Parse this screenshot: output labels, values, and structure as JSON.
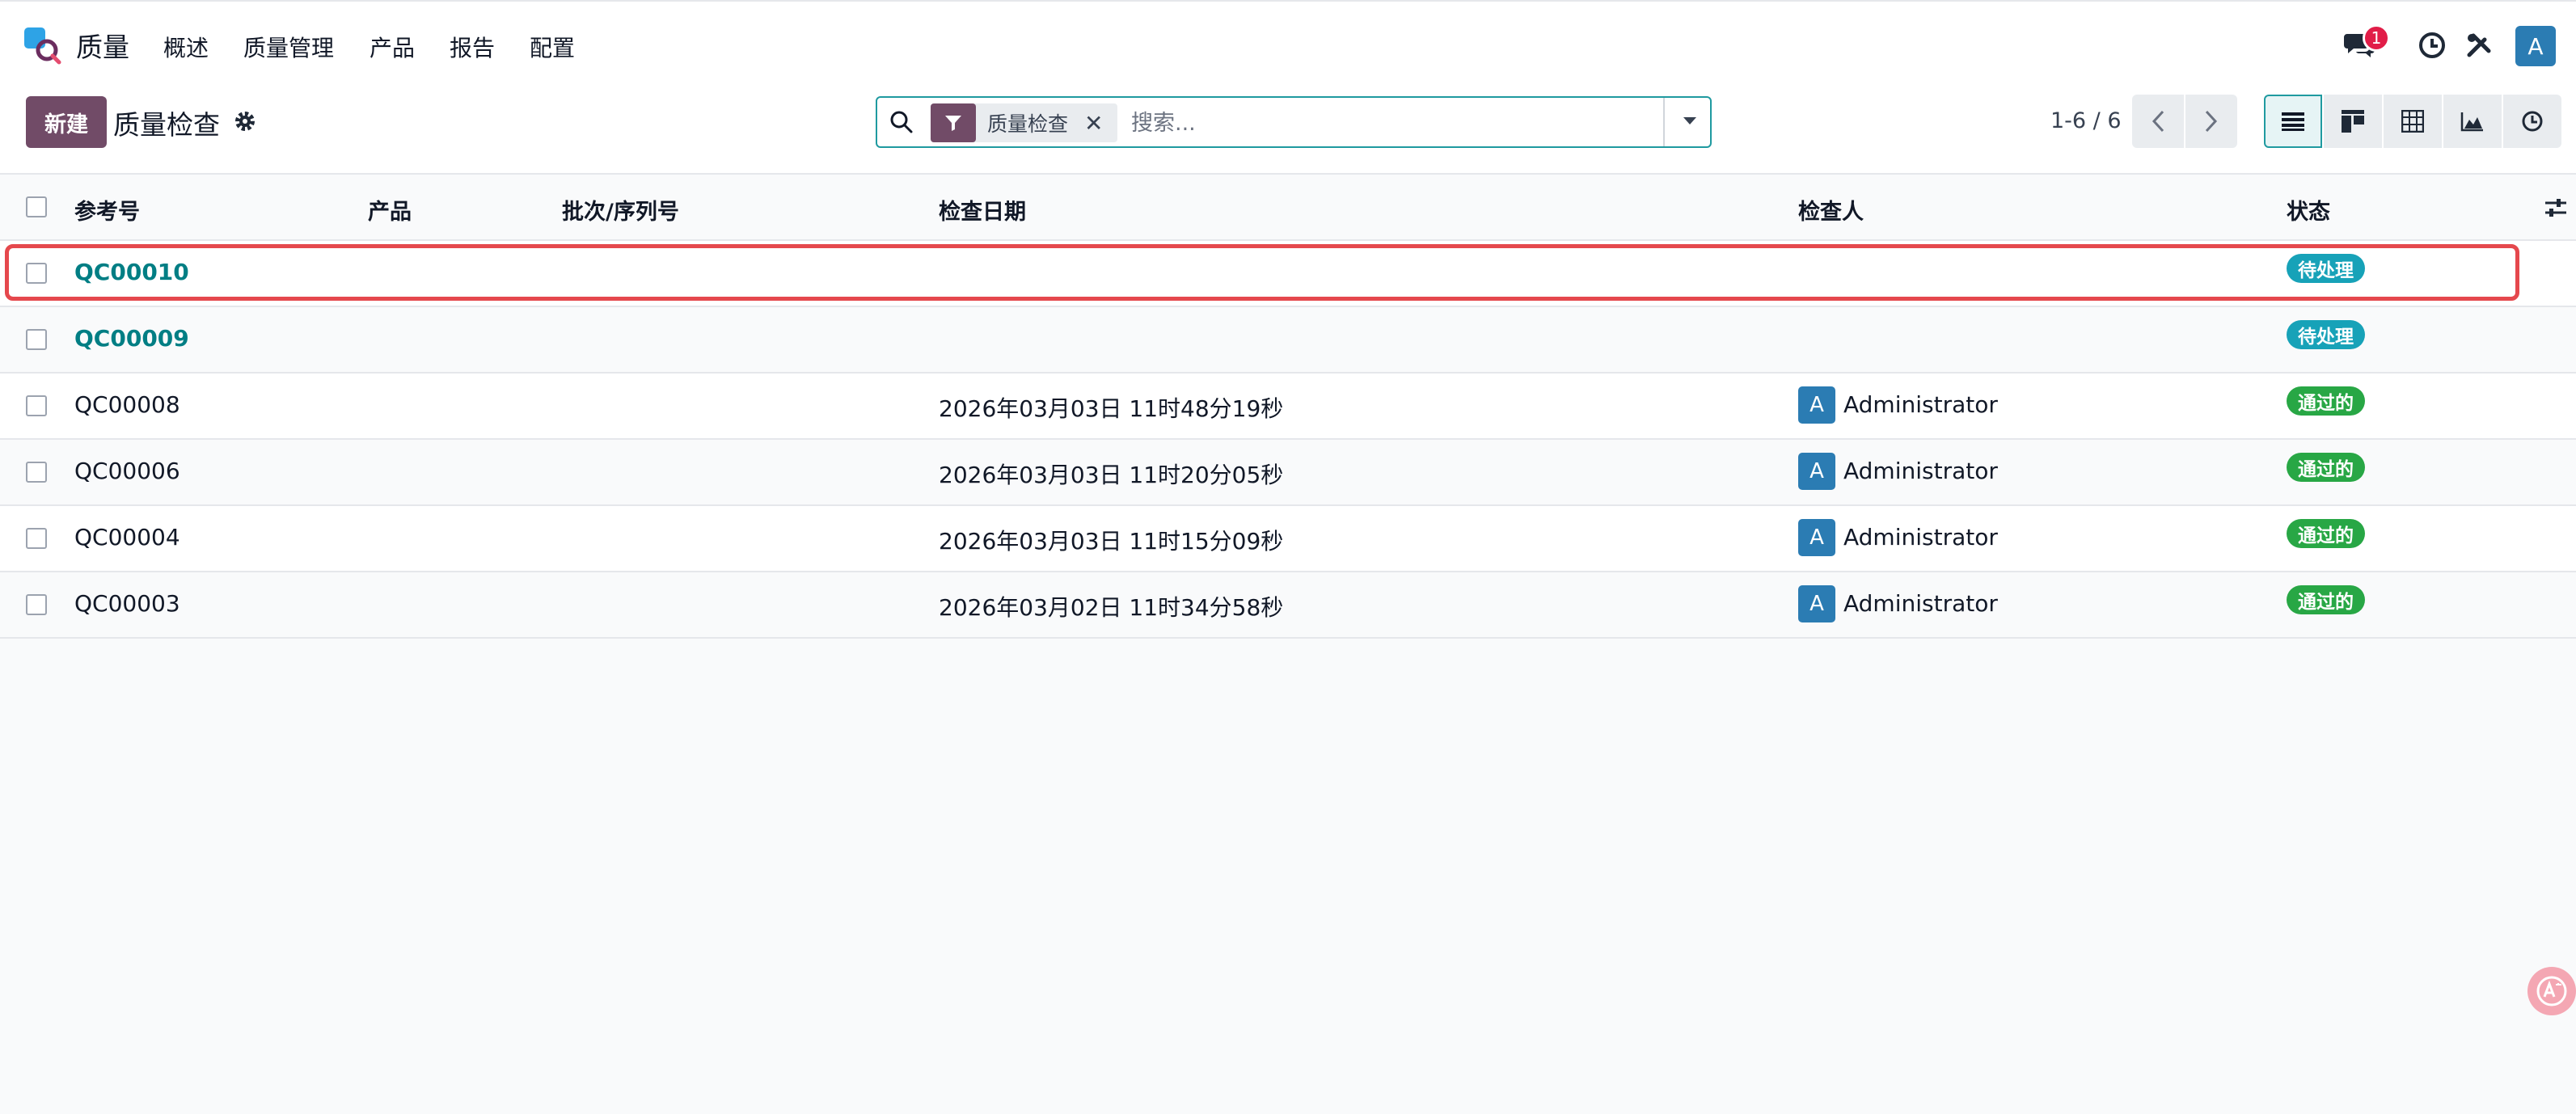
{
  "nav": {
    "app_name": "质量",
    "menu": [
      "概述",
      "质量管理",
      "产品",
      "报告",
      "配置"
    ],
    "messages_count": "1",
    "user_initial": "A"
  },
  "control": {
    "new_label": "新建",
    "title": "质量检查",
    "filter_facet": "质量检查",
    "search_placeholder": "搜索...",
    "pager": "1-6 / 6"
  },
  "table": {
    "headers": {
      "ref": "参考号",
      "product": "产品",
      "lot": "批次/序列号",
      "date": "检查日期",
      "inspector": "检查人",
      "status": "状态"
    },
    "rows": [
      {
        "ref": "QC00010",
        "date": "",
        "inspector": "",
        "inspector_initial": "",
        "status": "待处理",
        "status_color": "#17a2b8"
      },
      {
        "ref": "QC00009",
        "date": "",
        "inspector": "",
        "inspector_initial": "",
        "status": "待处理",
        "status_color": "#17a2b8"
      },
      {
        "ref": "QC00008",
        "date": "2026年03月03日 11时48分19秒",
        "inspector": "Administrator",
        "inspector_initial": "A",
        "status": "通过的",
        "status_color": "#28a745"
      },
      {
        "ref": "QC00006",
        "date": "2026年03月03日 11时20分05秒",
        "inspector": "Administrator",
        "inspector_initial": "A",
        "status": "通过的",
        "status_color": "#28a745"
      },
      {
        "ref": "QC00004",
        "date": "2026年03月03日 11时15分09秒",
        "inspector": "Administrator",
        "inspector_initial": "A",
        "status": "通过的",
        "status_color": "#28a745"
      },
      {
        "ref": "QC00003",
        "date": "2026年03月02日 11时34分58秒",
        "inspector": "Administrator",
        "inspector_initial": "A",
        "status": "通过的",
        "status_color": "#28a745"
      }
    ]
  },
  "colors": {
    "brand": "#714b67",
    "accent": "#017e84",
    "highlight": "#e5484d"
  }
}
